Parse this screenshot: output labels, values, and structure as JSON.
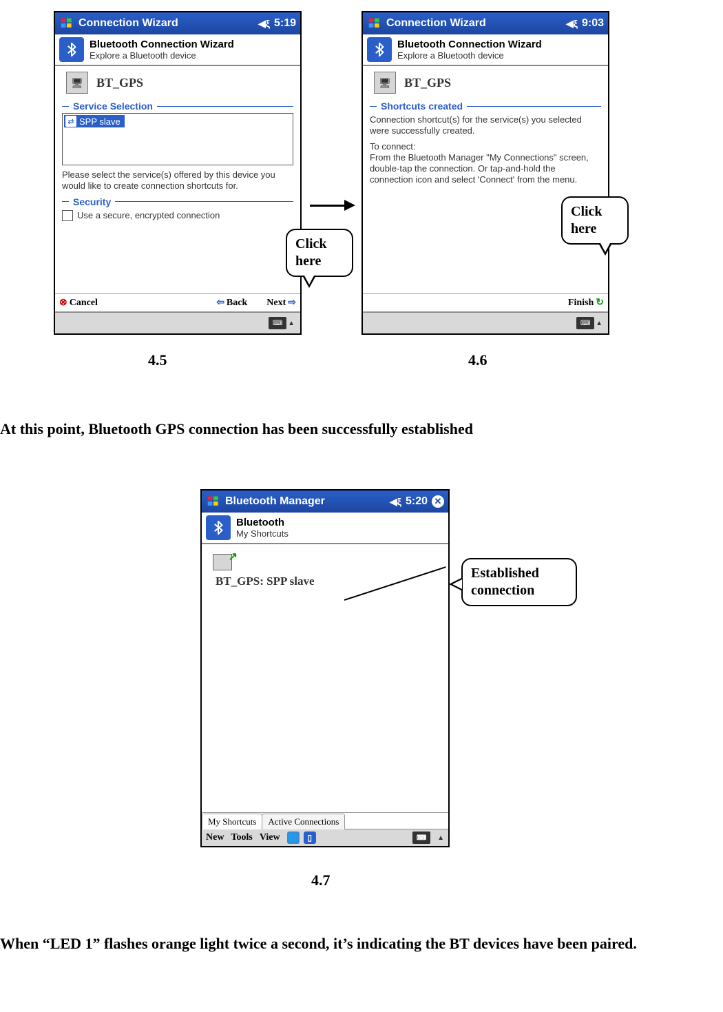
{
  "screen45": {
    "titlebar": {
      "title": "Connection Wizard",
      "time": "5:19"
    },
    "subheader": {
      "line1": "Bluetooth Connection Wizard",
      "line2": "Explore a Bluetooth device"
    },
    "device_label": "BT_GPS",
    "section_service": "Service Selection",
    "service_item": "SPP slave",
    "help_text": "Please select the service(s) offered by this device you would like to create connection shortcuts for.",
    "section_security": "Security",
    "checkbox_label": "Use a secure, encrypted connection",
    "nav": {
      "cancel": "Cancel",
      "back": "Back",
      "next": "Next"
    },
    "callout": "Click here"
  },
  "screen46": {
    "titlebar": {
      "title": "Connection Wizard",
      "time": "9:03"
    },
    "subheader": {
      "line1": "Bluetooth Connection Wizard",
      "line2": "Explore a Bluetooth device"
    },
    "device_label": "BT_GPS",
    "section_shortcuts": "Shortcuts created",
    "body1": "Connection shortcut(s) for the service(s) you selected were successfully created.",
    "body2": "To connect:",
    "body3": "From the Bluetooth Manager \"My Connections\" screen, double-tap the connection. Or tap-and-hold the connection icon and select 'Connect' from the menu.",
    "nav": {
      "finish": "Finish"
    },
    "callout": "Click here"
  },
  "screen47": {
    "titlebar": {
      "title": "Bluetooth Manager",
      "time": "5:20"
    },
    "subheader": {
      "line1": "Bluetooth",
      "line2": "My Shortcuts"
    },
    "shortcut_label": "BT_GPS: SPP slave",
    "tabs": {
      "active": "My Shortcuts",
      "inactive": "Active Connections"
    },
    "menu": {
      "new": "New",
      "tools": "Tools",
      "view": "View"
    },
    "callout": "Established connection"
  },
  "captions": {
    "c45": "4.5",
    "c46": "4.6",
    "c47": "4.7"
  },
  "text": {
    "line1": "At this point, Bluetooth GPS connection has been successfully established",
    "line2": "When “LED 1” flashes orange light twice a second, it’s indicating the BT devices have been paired."
  }
}
